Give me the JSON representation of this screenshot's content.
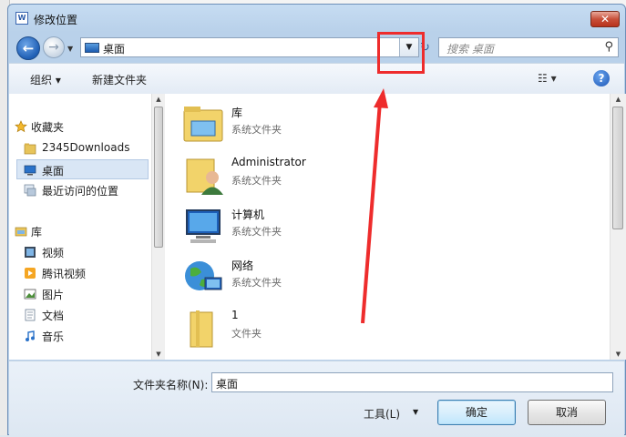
{
  "window": {
    "title": "修改位置",
    "close_glyph": "✕"
  },
  "nav": {
    "back_glyph": "←",
    "forward_glyph": "→",
    "address": "桌面",
    "search_placeholder": "搜索 桌面"
  },
  "toolbar": {
    "organize": "组织 ▾",
    "new_folder": "新建文件夹"
  },
  "sidebar": {
    "favorites": "收藏夹",
    "items": [
      "2345Downloads",
      "桌面",
      "最近访问的位置"
    ],
    "libraries": "库",
    "lib_items": [
      "视频",
      "腾讯视频",
      "图片",
      "文档",
      "音乐"
    ]
  },
  "files": [
    {
      "name": "库",
      "type": "系统文件夹"
    },
    {
      "name": "Administrator",
      "type": "系统文件夹"
    },
    {
      "name": "计算机",
      "type": "系统文件夹"
    },
    {
      "name": "网络",
      "type": "系统文件夹"
    },
    {
      "name": "1",
      "type": "文件夹"
    }
  ],
  "footer": {
    "folder_name_label": "文件夹名称(N):",
    "folder_name_value": "桌面",
    "tools": "工具(L)",
    "ok": "确定",
    "cancel": "取消"
  },
  "colors": {
    "highlight": "#ee2c2c",
    "accent": "#1f5fb5"
  }
}
